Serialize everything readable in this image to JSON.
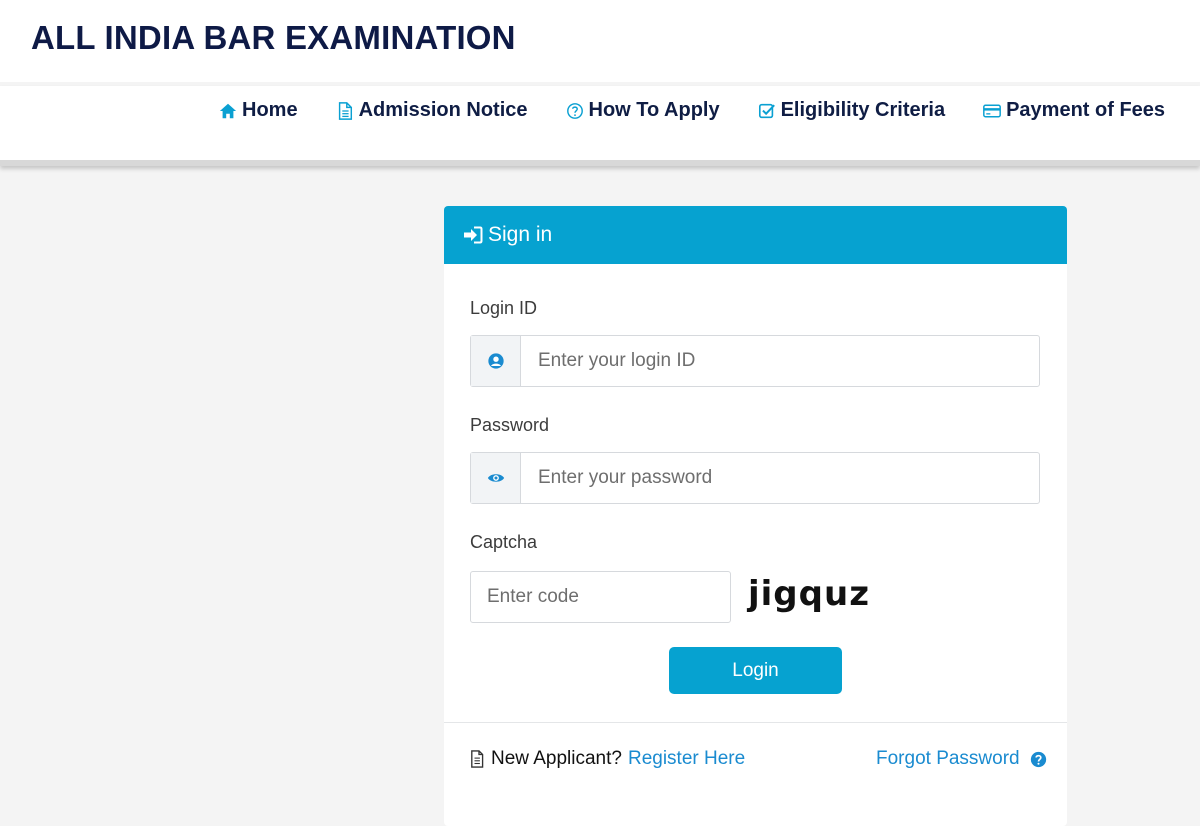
{
  "site": {
    "title": "ALL INDIA BAR EXAMINATION"
  },
  "nav": {
    "items": [
      {
        "label": "Home",
        "icon": "home-icon"
      },
      {
        "label": "Admission Notice",
        "icon": "document-icon"
      },
      {
        "label": "How To Apply",
        "icon": "question-circle-icon"
      },
      {
        "label": "Eligibility Criteria",
        "icon": "check-square-icon"
      },
      {
        "label": "Payment of Fees",
        "icon": "credit-card-icon"
      }
    ]
  },
  "signin": {
    "header": "Sign in",
    "header_icon": "sign-in-icon",
    "login_label": "Login ID",
    "login_placeholder": "Enter your login ID",
    "login_icon": "user-circle-icon",
    "password_label": "Password",
    "password_placeholder": "Enter your password",
    "password_icon": "eye-icon",
    "captcha_label": "Captcha",
    "captcha_placeholder": "Enter code",
    "captcha_code": "jigquz",
    "login_button": "Login"
  },
  "footer": {
    "new_applicant_text": "New Applicant?",
    "register_link": "Register Here",
    "forgot_link": "Forgot Password",
    "forgot_icon": "question-circle-icon"
  },
  "colors": {
    "primary": "#06a2d0",
    "link": "#1a8bd0",
    "title": "#0e1a46",
    "background": "#f4f4f4"
  }
}
